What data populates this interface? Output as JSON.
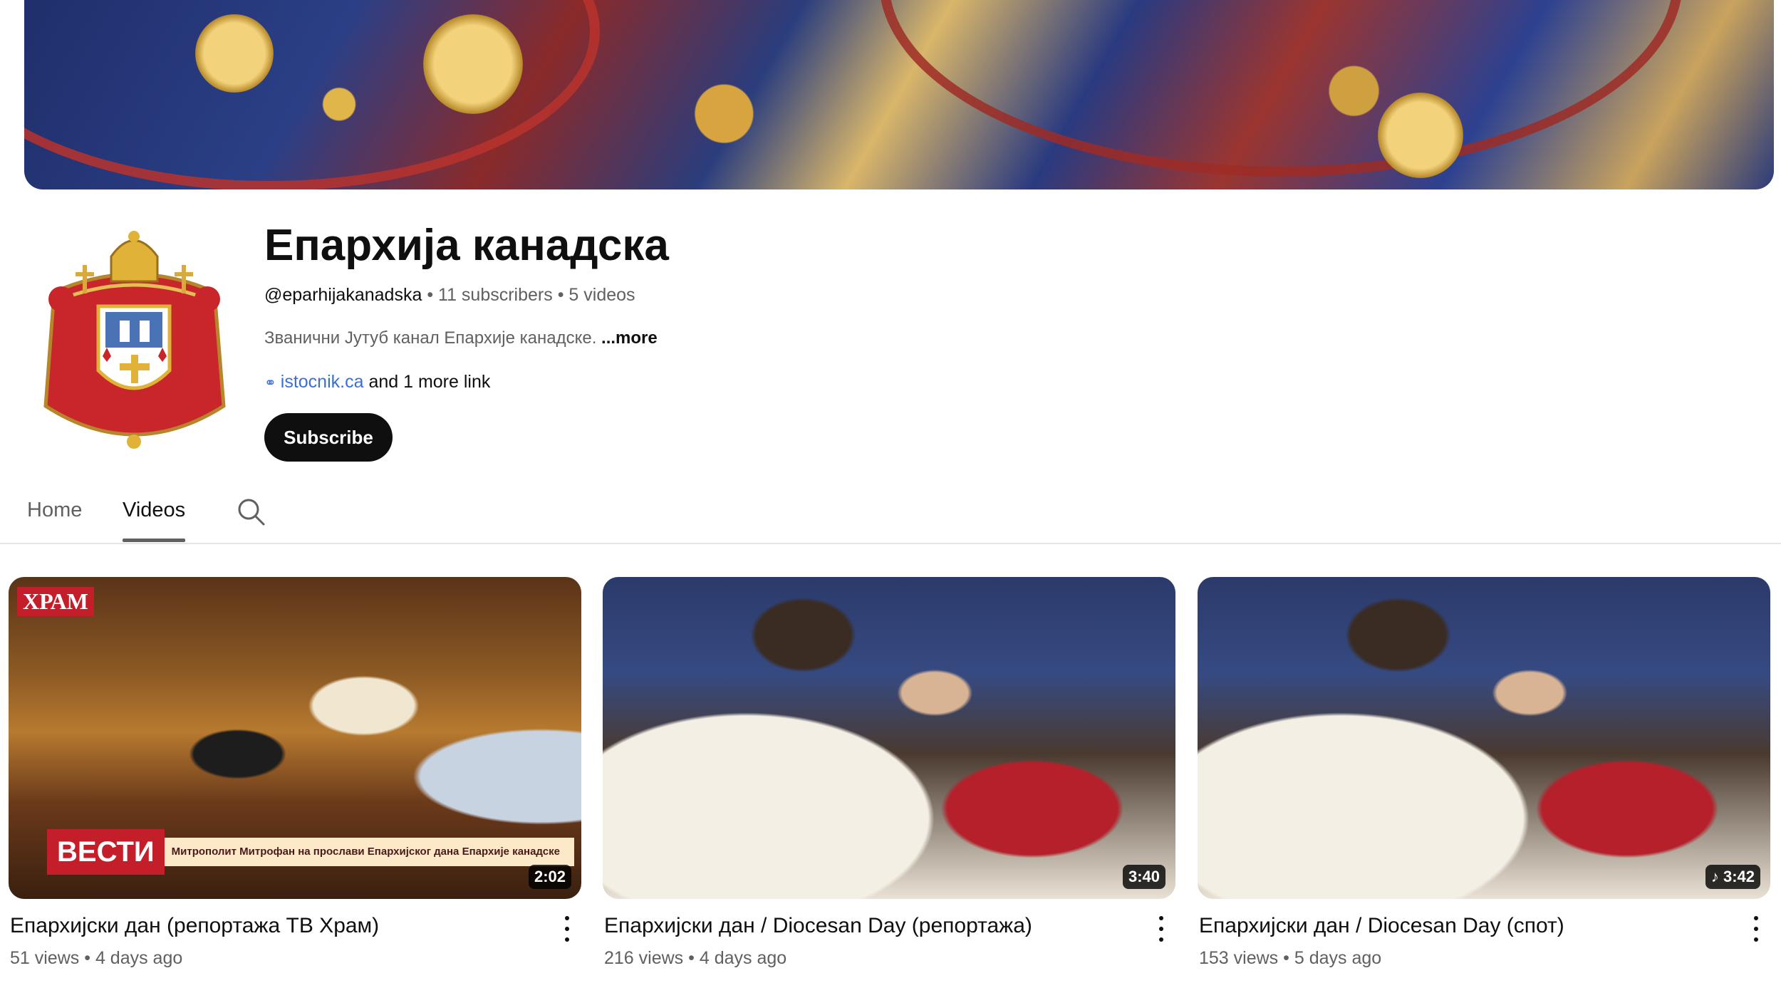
{
  "channel": {
    "name": "Епархија канадска",
    "handle": "@eparhijakanadska",
    "subscribers": "11 subscribers",
    "videos_count": "5 videos",
    "description": "Званични Јутуб канал Епархије канадске.",
    "more_label": "...more",
    "link_text": "istocnik.ca",
    "more_links": "and 1 more link",
    "subscribe_label": "Subscribe"
  },
  "tabs": [
    {
      "label": "Home"
    },
    {
      "label": "Videos"
    }
  ],
  "videos": [
    {
      "title": "Епархијски дан (репортажа ТВ Храм)",
      "duration": "2:02",
      "views": "51 views",
      "age": "4 days ago",
      "overlay_logo": "ХРАМ",
      "overlay_tag": "ВЕСТИ",
      "overlay_caption": "Митрополит Митрофан на прослави Епархијског дана Епархије канадске"
    },
    {
      "title": "Епархијски дан / Diocesan Day (репортажа)",
      "duration": "3:40",
      "views": "216 views",
      "age": "4 days ago"
    },
    {
      "title": "Епархијски дан / Diocesan Day (спот)",
      "duration": "3:42",
      "duration_icon": "music-note-icon",
      "views": "153 views",
      "age": "5 days ago"
    }
  ],
  "meta_separator": "•",
  "colors": {
    "subscribe_bg": "#0f0f0f",
    "link": "#3b6fd6",
    "secondary_text": "#606060",
    "news_red": "#c41e2a"
  }
}
